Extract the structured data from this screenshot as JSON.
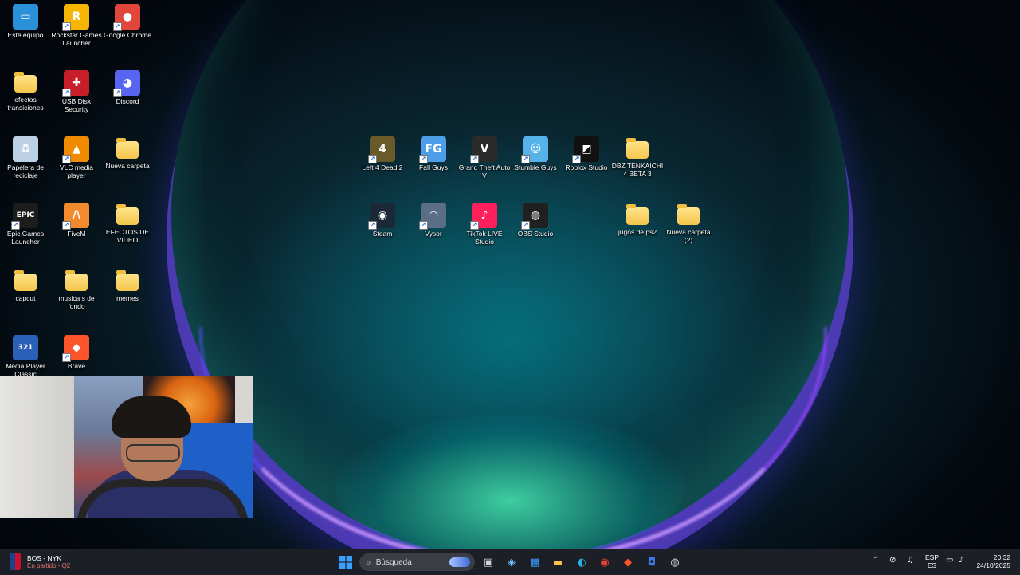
{
  "desktop": {
    "icons": [
      {
        "label": "Este equipo",
        "icon": "monitor-icon",
        "glyph": "▭",
        "bg": "#2a90d9"
      },
      {
        "label": "Rockstar Games Launcher",
        "icon": "rockstar-icon",
        "glyph": "R",
        "bg": "#f6b500"
      },
      {
        "label": "Google Chrome",
        "icon": "chrome-icon",
        "glyph": "●",
        "bg": "#e0473a"
      },
      {
        "label": "efectos transiciones",
        "icon": "folder-icon",
        "glyph": "",
        "bg": ""
      },
      {
        "label": "USB Disk Security",
        "icon": "shield-icon",
        "glyph": "✚",
        "bg": "#c81e2a"
      },
      {
        "label": "Discord",
        "icon": "discord-icon",
        "glyph": "◕",
        "bg": "#5865f2"
      },
      {
        "label": "Papelera de reciclaje",
        "icon": "recycle-bin-icon",
        "glyph": "♻",
        "bg": "#bcd0e6"
      },
      {
        "label": "VLC media player",
        "icon": "vlc-icon",
        "glyph": "▲",
        "bg": "#f08a00"
      },
      {
        "label": "Nueva carpeta",
        "icon": "folder-icon",
        "glyph": "",
        "bg": ""
      },
      {
        "label": "Epic Games Launcher",
        "icon": "epic-games-icon",
        "glyph": "EPIC",
        "bg": "#1c1c1c"
      },
      {
        "label": "FiveM",
        "icon": "fivem-icon",
        "glyph": "/\\",
        "bg": "#f28b2e"
      },
      {
        "label": "EFECTOS DE VIDEO",
        "icon": "folder-icon",
        "glyph": "",
        "bg": ""
      },
      {
        "label": "capcut",
        "icon": "folder-icon",
        "glyph": "",
        "bg": ""
      },
      {
        "label": "musica s de fondo",
        "icon": "folder-icon",
        "glyph": "",
        "bg": ""
      },
      {
        "label": "memes",
        "icon": "folder-icon",
        "glyph": "",
        "bg": ""
      },
      {
        "label": "Media Player Classic",
        "icon": "media-player-classic-icon",
        "glyph": "321",
        "bg": "#2b5fb8"
      },
      {
        "label": "Brave",
        "icon": "brave-icon",
        "glyph": "◆",
        "bg": "#fb542b"
      },
      {
        "label": "Left 4 Dead 2",
        "icon": "left4dead2-icon",
        "glyph": "4",
        "bg": "#6a5a2a"
      },
      {
        "label": "Fall Guys",
        "icon": "fall-guys-icon",
        "glyph": "FG",
        "bg": "#4d9ee8"
      },
      {
        "label": "Grand Theft Auto V",
        "icon": "gta-v-icon",
        "glyph": "V",
        "bg": "#2b2b2b"
      },
      {
        "label": "Stumble Guys",
        "icon": "stumble-guys-icon",
        "glyph": "☺",
        "bg": "#56b2e8"
      },
      {
        "label": "Roblox Studio",
        "icon": "roblox-studio-icon",
        "glyph": "◩",
        "bg": "#111111"
      },
      {
        "label": "DBZ TENKAICHI 4 BETA 3",
        "icon": "folder-icon",
        "glyph": "",
        "bg": ""
      },
      {
        "label": "Steam",
        "icon": "steam-icon",
        "glyph": "◉",
        "bg": "#1b2838"
      },
      {
        "label": "Vysor",
        "icon": "vysor-icon",
        "glyph": "◠",
        "bg": "#5a6f86"
      },
      {
        "label": "TikTok LIVE Studio",
        "icon": "tiktok-live-studio-icon",
        "glyph": "♪",
        "bg": "#ff1f5a"
      },
      {
        "label": "OBS Studio",
        "icon": "obs-studio-icon",
        "glyph": "◍",
        "bg": "#202020"
      },
      {
        "label": "jugos de ps2",
        "icon": "folder-icon",
        "glyph": "",
        "bg": ""
      },
      {
        "label": "Nueva carpeta (2)",
        "icon": "folder-icon",
        "glyph": "",
        "bg": ""
      }
    ]
  },
  "taskbar": {
    "widget": {
      "title": "BOS - NYK",
      "subtitle": "En partido - Q2",
      "icon": "nba-icon"
    },
    "start_icon": "windows-start-icon",
    "search_placeholder": "Búsqueda",
    "pinned": [
      {
        "name": "task-view-icon",
        "glyph": "▣",
        "color": "#cfd3da"
      },
      {
        "name": "copilot-icon",
        "glyph": "◈",
        "color": "#6fc3ff"
      },
      {
        "name": "microsoft-store-icon",
        "glyph": "▦",
        "color": "#3aa0ff"
      },
      {
        "name": "file-explorer-icon",
        "glyph": "▬",
        "color": "#f7c648"
      },
      {
        "name": "edge-icon",
        "glyph": "◐",
        "color": "#2bb3e6"
      },
      {
        "name": "chrome-icon",
        "glyph": "◉",
        "color": "#e94235"
      },
      {
        "name": "brave-icon",
        "glyph": "◆",
        "color": "#fb542b"
      },
      {
        "name": "roblox-icon",
        "glyph": "◘",
        "color": "#3b7be8"
      },
      {
        "name": "obs-icon",
        "glyph": "◍",
        "color": "#dcdcdc"
      }
    ],
    "tray": {
      "language_top": "ESP",
      "language_bottom": "ES",
      "time": "20:32",
      "date": "24/10/2025"
    }
  }
}
